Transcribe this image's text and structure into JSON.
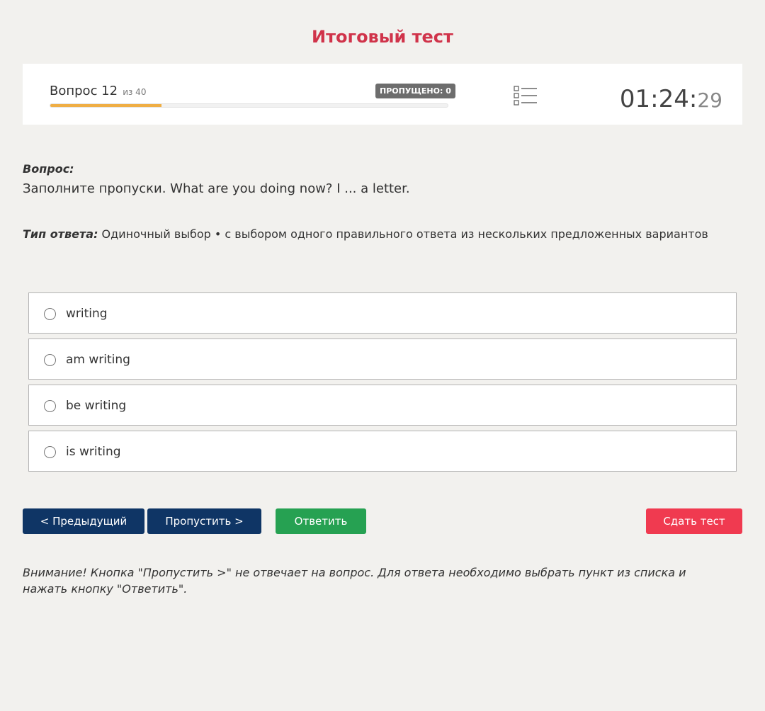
{
  "page": {
    "title": "Итоговый тест"
  },
  "status": {
    "question_label": "Вопрос 12",
    "question_of": "из 40",
    "progress_fraction": 0.28,
    "skipped_badge": "ПРОПУЩЕНО: 0",
    "list_icon": "list-icon",
    "timer_main": "01:24:",
    "timer_seconds": "29",
    "accent_color": "#efae45"
  },
  "question": {
    "label": "Вопрос:",
    "text": "Заполните пропуски. What are you doing now? I ... a letter.",
    "answer_type_label": "Тип ответа:",
    "answer_type_text": " Одиночный выбор • с выбором одного правильного ответа из нескольких предложенных вариантов"
  },
  "options": [
    {
      "label": "writing",
      "selected": false
    },
    {
      "label": "am writing",
      "selected": false
    },
    {
      "label": "be writing",
      "selected": false
    },
    {
      "label": "is writing",
      "selected": false
    }
  ],
  "buttons": {
    "prev": "< Предыдущий",
    "skip": "Пропустить >",
    "answer": "Ответить",
    "finish": "Сдать тест"
  },
  "note": "Внимание! Кнопка \"Пропустить >\" не отвечает на вопрос. Для ответа необходимо выбрать пункт из списка и нажать кнопку \"Ответить\".",
  "colors": {
    "title": "#d0334a",
    "nav_button": "#0f3565",
    "answer_button": "#26a152",
    "finish_button": "#f03a50"
  }
}
